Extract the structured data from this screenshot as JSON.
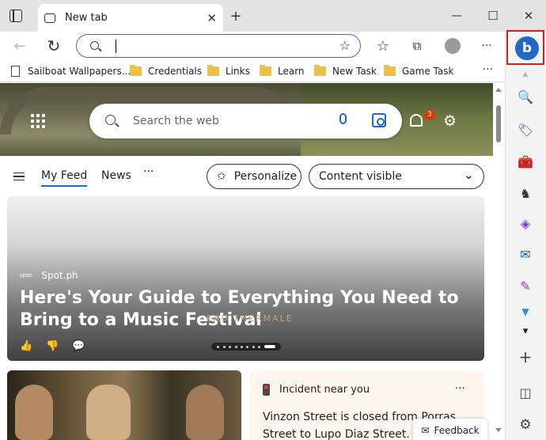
{
  "window": {
    "tab_title": "New tab",
    "new_tab_label": "+",
    "minimize_label": "—",
    "maximize_label": "☐",
    "close_label": "✕"
  },
  "toolbar": {
    "back_label": "←",
    "refresh_label": "↻",
    "address_value": "",
    "favorites_label": "☆",
    "collections_label": "⧉",
    "more_label": "···"
  },
  "favorites": [
    {
      "label": "Sailboat Wallpapers...",
      "icon": "page-icon"
    },
    {
      "label": "Credentials",
      "icon": "folder-icon"
    },
    {
      "label": "Links",
      "icon": "folder-icon"
    },
    {
      "label": "Learn",
      "icon": "folder-icon"
    },
    {
      "label": "New Task",
      "icon": "folder-icon"
    },
    {
      "label": "Game Task",
      "icon": "folder-icon"
    }
  ],
  "favbar_more": "···",
  "newtab": {
    "search_placeholder": "Search the web",
    "notification_count": "3",
    "settings_glyph": "⚙",
    "feed_tabs": [
      {
        "label": "My Feed",
        "active": true
      },
      {
        "label": "News",
        "active": false
      }
    ],
    "feed_more": "···",
    "personalize_label": "Personalize",
    "content_visible_label": "Content visible",
    "content_caret": "⌄"
  },
  "main_card": {
    "source": "Spot.ph",
    "source_logo": "spot.",
    "headline": "Here's Your Guide to Everything You Need to Bring to a Music Festival",
    "watermark": "EAU THERMALE",
    "actions": [
      "👍",
      "👎",
      "💬"
    ]
  },
  "incident_card": {
    "header": "Incident near you",
    "menu": "···",
    "body": "Vinzon Street is closed from Porras Street to Lupo Diaz Street."
  },
  "feedback_label": "Feedback",
  "sidebar": {
    "bing_label": "b",
    "items": [
      {
        "name": "search-icon",
        "glyph": "🔍"
      },
      {
        "name": "shopping-tag-icon",
        "glyph": "🏷"
      },
      {
        "name": "toolbox-icon",
        "glyph": "🧰"
      },
      {
        "name": "games-icon",
        "glyph": "♞"
      },
      {
        "name": "office-icon",
        "glyph": "◈"
      },
      {
        "name": "outlook-icon",
        "glyph": "✉"
      },
      {
        "name": "designer-icon",
        "glyph": "✎"
      },
      {
        "name": "drop-icon",
        "glyph": "▼"
      }
    ],
    "more_glyph": "▾",
    "add_glyph": "+",
    "split_glyph": "◫",
    "settings_glyph": "⚙"
  },
  "colors": {
    "accent": "#2468c6",
    "highlight_box": "#d02020",
    "badge": "#d83b01",
    "folder": "#e9c14b"
  }
}
